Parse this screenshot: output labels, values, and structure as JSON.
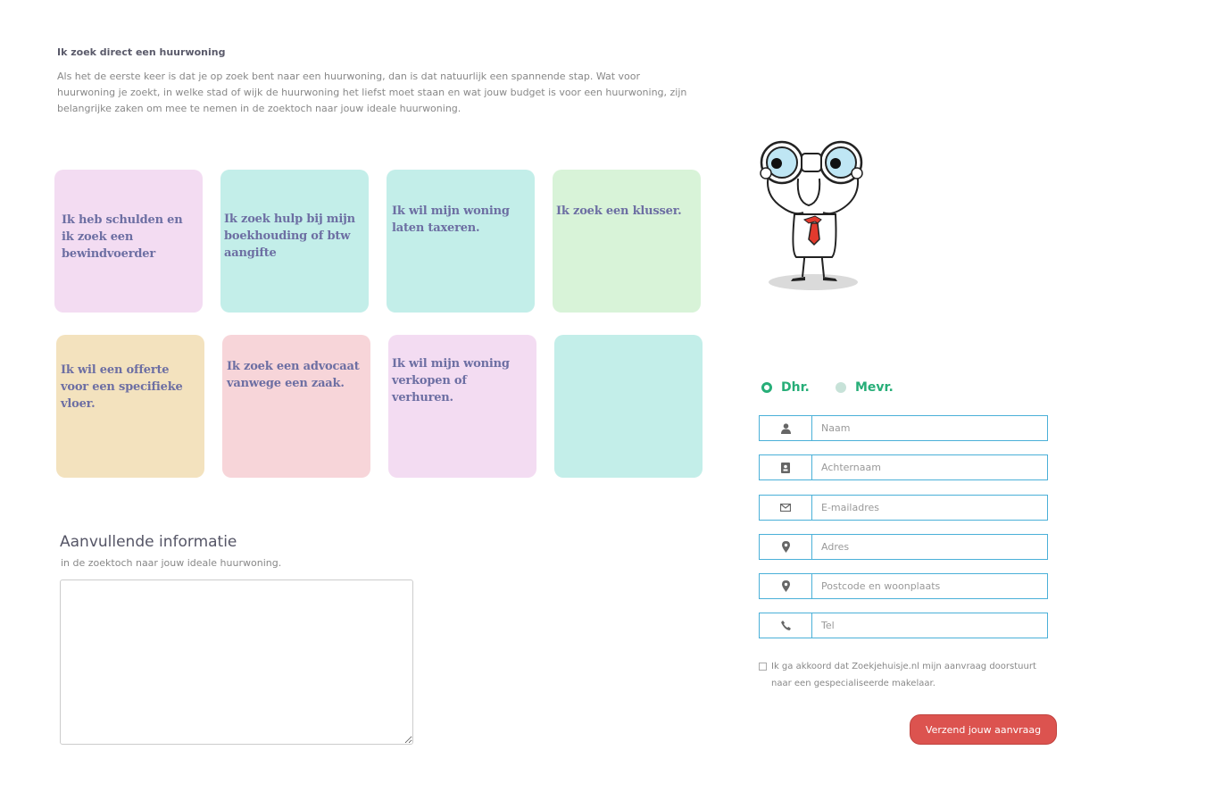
{
  "intro": {
    "title": "Ik zoek direct een huurwoning",
    "text": "Als het de eerste keer is dat je op zoek bent naar een huurwoning, dan is dat natuurlijk een spannende stap. Wat voor huurwoning je zoekt, in welke stad of wijk de huurwoning het liefst moet staan en wat jouw budget is voor een huurwoning, zijn belangrijke zaken om mee te nemen in de zoektoch naar jouw ideale huurwoning."
  },
  "cards": [
    {
      "label": "Ik heb schulden en ik zoek een bewindvoerder",
      "color": "#f3dcf2"
    },
    {
      "label": "Ik zoek hulp bij mijn boekhouding of btw aangifte",
      "color": "#c3eee9"
    },
    {
      "label": "Ik wil mijn woning laten taxeren.",
      "color": "#c3eee9"
    },
    {
      "label": "Ik zoek een klusser.",
      "color": "#d8f3d8"
    },
    {
      "label": "Ik wil een offerte voor een specifieke vloer.",
      "color": "#f3e2be"
    },
    {
      "label": "Ik zoek een advocaat vanwege een zaak.",
      "color": "#f7d5d9"
    },
    {
      "label": "Ik wil mijn woning verkopen of verhuren.",
      "color": "#f3dcf2"
    },
    {
      "label": "",
      "color": "#c3eee9"
    }
  ],
  "extra": {
    "title": "Aanvullende informatie",
    "subtitle": "in de zoektoch naar jouw ideale huurwoning.",
    "value": ""
  },
  "gender": {
    "male": "Dhr.",
    "female": "Mevr.",
    "selected": "Dhr."
  },
  "form": {
    "fields": [
      {
        "placeholder": "Naam",
        "icon": "user-icon"
      },
      {
        "placeholder": "Achternaam",
        "icon": "id-card-icon"
      },
      {
        "placeholder": "E-mailadres",
        "icon": "envelope-icon"
      },
      {
        "placeholder": "Adres",
        "icon": "map-marker-icon"
      },
      {
        "placeholder": "Postcode en woonplaats",
        "icon": "map-marker-icon"
      },
      {
        "placeholder": "Tel",
        "icon": "phone-icon"
      }
    ],
    "consent": "Ik ga akkoord dat Zoekjehuisje.nl mijn aanvraag doorstuurt naar een gespecialiseerde makelaar.",
    "submit": "Verzend jouw aanvraag"
  },
  "colors": {
    "accent_green": "#27ae78",
    "field_border": "#4ab0d8",
    "button": "#dc534f",
    "card_text": "#6d6fa3"
  }
}
